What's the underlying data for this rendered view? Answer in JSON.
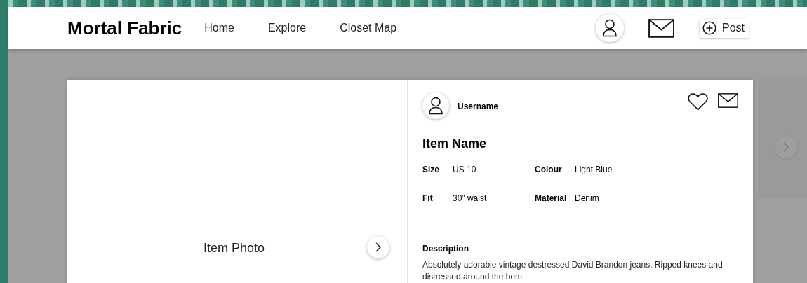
{
  "app": {
    "title": "Mortal Fabric"
  },
  "nav": [
    "Home",
    "Explore",
    "Closet Map"
  ],
  "header_actions": {
    "post_button": "Post"
  },
  "item_modal": {
    "photo_label": "Item Photo",
    "username": "Username",
    "item_name": "Item Name",
    "attributes": [
      {
        "label": "Size",
        "value": "US 10"
      },
      {
        "label": "Colour",
        "value": "Light Blue"
      },
      {
        "label": "Fit",
        "value": "30\" waist"
      },
      {
        "label": "Material",
        "value": "Denim"
      }
    ],
    "description_heading": "Description",
    "description": "Absolutely adorable vintage destressed David Brandon jeans. Ripped knees and distressed around the hem."
  }
}
